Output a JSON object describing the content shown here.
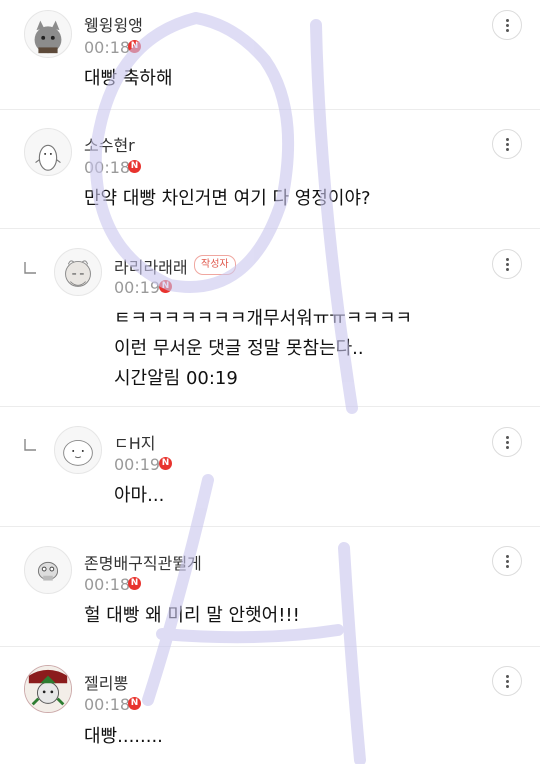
{
  "comments": [
    {
      "name": "웽윙윙앵",
      "time": "00:18",
      "new": "N",
      "lines": [
        "대빵 축하해"
      ]
    },
    {
      "name": "소수현r",
      "time": "00:18",
      "new": "N",
      "lines": [
        "만약 대빵 차인거면 여기 다 영정이야?"
      ]
    },
    {
      "name": "라리라래래",
      "author_badge": "작성자",
      "time": "00:19",
      "new": "N",
      "lines": [
        "ㅌㅋㅋㅋㅋㅋㅋㅋ개무서워ㅠㅠㅋㅋㅋㅋ",
        "이런 무서운 댓글 정말 못참는다..",
        "시간알림 00:19"
      ]
    },
    {
      "name": "ㄷH지",
      "time": "00:19",
      "new": "N",
      "lines": [
        "아마..."
      ]
    },
    {
      "name": "존명배구직관뛸게",
      "time": "00:18",
      "new": "N",
      "lines": [
        "헐 대빵 왜 미리 말 안햇어!!!"
      ]
    },
    {
      "name": "젤리뽕",
      "time": "00:18",
      "new": "N",
      "lines": [
        "대빵........"
      ]
    }
  ],
  "colors": {
    "new_badge": "#e8332e",
    "author_badge": "#e05a4e",
    "watermark": "#c9c6ee"
  },
  "icons": {
    "more": "more-vertical-icon",
    "reply": "reply-arrow-icon",
    "new": "new-badge"
  }
}
